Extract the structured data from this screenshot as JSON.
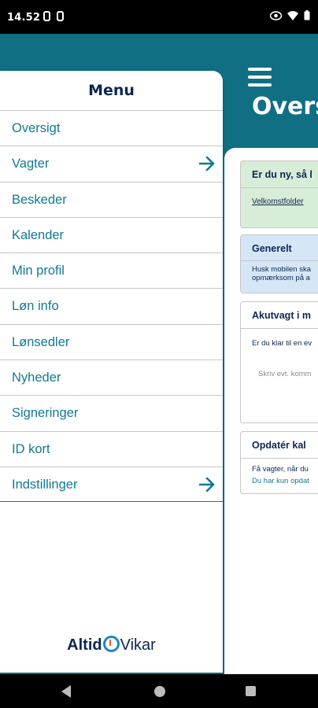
{
  "status_bar": {
    "time": "14.52"
  },
  "background": {
    "title": "Overs",
    "cards": [
      {
        "title": "Er du ny, så l",
        "link": "Velkomstfolder"
      },
      {
        "title": "Generelt",
        "lines": [
          "Husk mobilen ska",
          "opmærksom på a"
        ]
      },
      {
        "title": "Akutvagt i m",
        "lines": [
          "Er du klar til en ev",
          "Skriv evt. komm"
        ]
      },
      {
        "title": "Opdatér kal",
        "lines": [
          "Få vagter, når du",
          "Du har kun opdat"
        ]
      }
    ]
  },
  "drawer": {
    "title": "Menu",
    "items": [
      {
        "label": "Oversigt",
        "arrow": false
      },
      {
        "label": "Vagter",
        "arrow": true
      },
      {
        "label": "Beskeder",
        "arrow": false
      },
      {
        "label": "Kalender",
        "arrow": false
      },
      {
        "label": "Min profil",
        "arrow": false
      },
      {
        "label": "Løn info",
        "arrow": false
      },
      {
        "label": "Lønsedler",
        "arrow": false
      },
      {
        "label": "Nyheder",
        "arrow": false
      },
      {
        "label": "Signeringer",
        "arrow": false
      },
      {
        "label": "ID kort",
        "arrow": false
      },
      {
        "label": "Indstillinger",
        "arrow": true
      }
    ],
    "logo": {
      "part1": "Altid",
      "part2": "Vikar"
    }
  },
  "colors": {
    "accent": "#116f84",
    "link": "#117a93",
    "navy": "#0c2650"
  }
}
